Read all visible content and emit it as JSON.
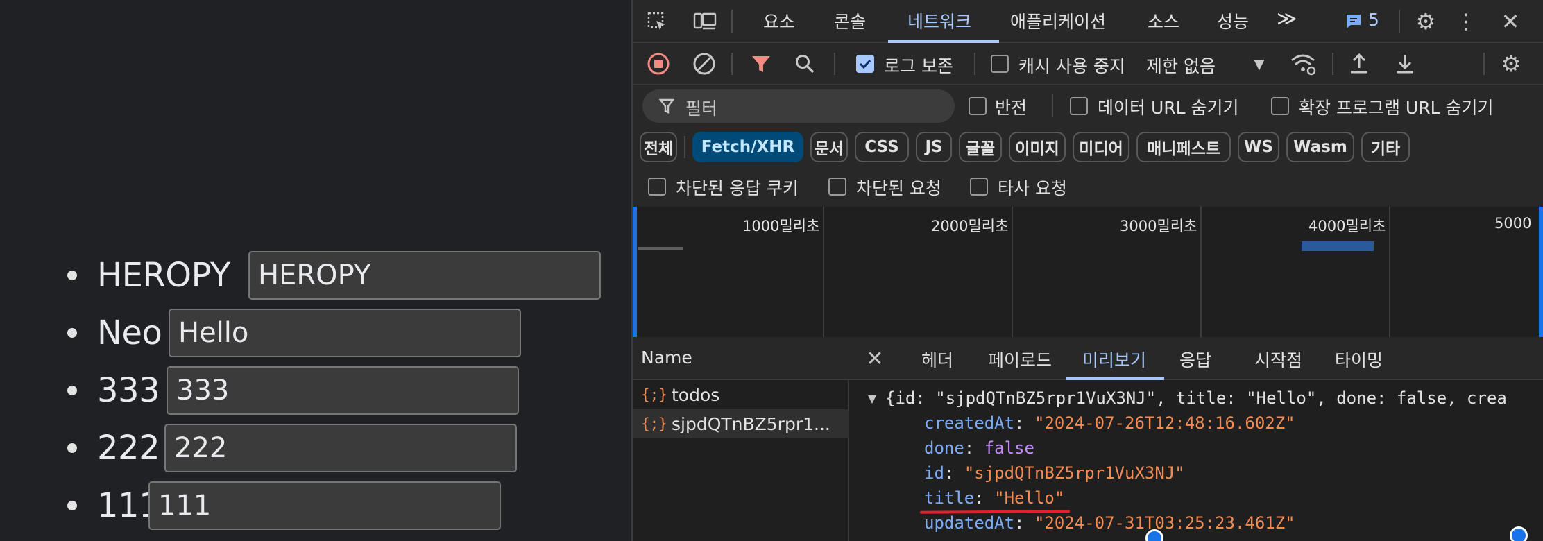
{
  "todos": [
    {
      "text": "HEROPY",
      "value": "HEROPY"
    },
    {
      "text": "Neo",
      "value": "Hello"
    },
    {
      "text": "333",
      "value": "333"
    },
    {
      "text": "222",
      "value": "222"
    },
    {
      "text": "111",
      "value": "111"
    }
  ],
  "devtools": {
    "main_tabs": [
      "요소",
      "콘솔",
      "네트워크",
      "애플리케이션",
      "소스",
      "성능"
    ],
    "active_tab": "네트워크",
    "more_tabs_glyph": "≫",
    "issues_count": "5",
    "toolbar": {
      "preserve_log_label": "로그 보존",
      "preserve_log_checked": true,
      "disable_cache_label": "캐시 사용 중지",
      "disable_cache_checked": false,
      "throttle_value": "제한 없음"
    },
    "filter": {
      "placeholder": "필터",
      "invert_label": "반전",
      "hide_data_urls_label": "데이터 URL 숨기기",
      "hide_extension_urls_label": "확장 프로그램 URL 숨기기",
      "type_chips": [
        "전체",
        "Fetch/XHR",
        "문서",
        "CSS",
        "JS",
        "글꼴",
        "이미지",
        "미디어",
        "매니페스트",
        "WS",
        "Wasm",
        "기타"
      ],
      "active_chip": "Fetch/XHR",
      "blocked_cookies_label": "차단된 응답 쿠키",
      "blocked_requests_label": "차단된 요청",
      "third_party_label": "타사 요청"
    },
    "overview": {
      "ticks": [
        "1000밀리초",
        "2000밀리초",
        "3000밀리초",
        "4000밀리초",
        "5000"
      ]
    },
    "requests": {
      "header": "Name",
      "items": [
        {
          "icon": "{;}",
          "name": "todos"
        },
        {
          "icon": "{;}",
          "name": "sjpdQTnBZ5rpr1..."
        }
      ]
    },
    "detail_tabs": [
      "헤더",
      "페이로드",
      "미리보기",
      "응답",
      "시작점",
      "타이밍"
    ],
    "active_detail_tab": "미리보기",
    "preview": {
      "summary": "{id: \"sjpdQTnBZ5rpr1VuX3NJ\", title: \"Hello\", done: false, crea",
      "fields": [
        {
          "key": "createdAt",
          "value": "\"2024-07-26T12:48:16.602Z\"",
          "kind": "string"
        },
        {
          "key": "done",
          "value": "false",
          "kind": "keyword"
        },
        {
          "key": "id",
          "value": "\"sjpdQTnBZ5rpr1VuX3NJ\"",
          "kind": "string"
        },
        {
          "key": "title",
          "value": "\"Hello\"",
          "kind": "string"
        },
        {
          "key": "updatedAt",
          "value": "\"2024-07-31T03:25:23.461Z\"",
          "kind": "string"
        }
      ]
    },
    "colors": {
      "accent": "#a8c7fa",
      "record": "#f28b82",
      "filter_active": "#f28b82",
      "annotation": "#e3202f"
    }
  }
}
